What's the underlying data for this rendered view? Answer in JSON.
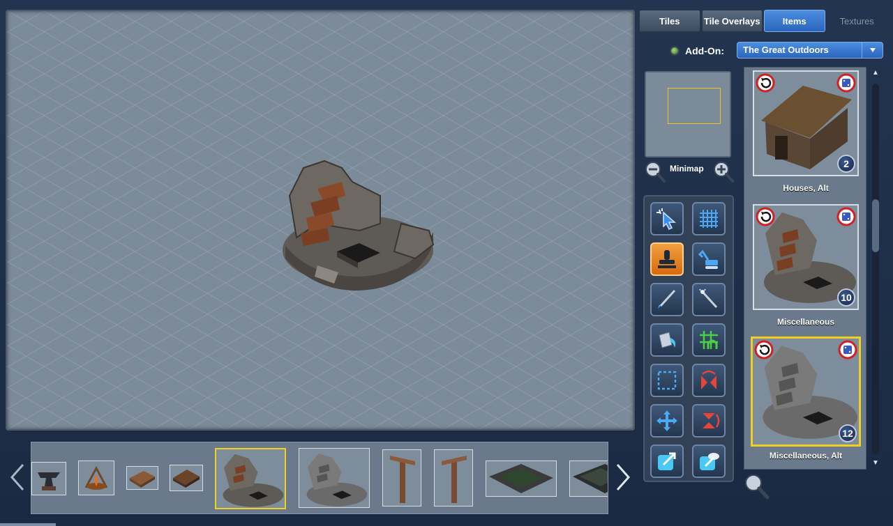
{
  "tabs": [
    {
      "label": "Tiles",
      "state": "normal"
    },
    {
      "label": "Tile Overlays",
      "state": "normal"
    },
    {
      "label": "Items",
      "state": "active"
    },
    {
      "label": "Textures",
      "state": "disabled"
    }
  ],
  "addon": {
    "label": "Add-On:",
    "selected": "The Great Outdoors"
  },
  "minimap": {
    "label": "Minimap"
  },
  "tools": [
    {
      "name": "select-tool",
      "icon": "cursor-sparkle-icon"
    },
    {
      "name": "grid-toggle-tool",
      "icon": "grid-icon"
    },
    {
      "name": "stamp-tool",
      "icon": "stamp-icon",
      "active": true
    },
    {
      "name": "excavate-tool",
      "icon": "excavator-icon"
    },
    {
      "name": "brush-tool",
      "icon": "brush-icon"
    },
    {
      "name": "magic-wand-tool",
      "icon": "magic-wand-icon"
    },
    {
      "name": "fill-tool",
      "icon": "paint-bucket-icon"
    },
    {
      "name": "walkable-grid-tool",
      "icon": "green-grid-arch-icon"
    },
    {
      "name": "marquee-tool",
      "icon": "marquee-icon"
    },
    {
      "name": "flip-horizontal-tool",
      "icon": "flip-horizontal-icon"
    },
    {
      "name": "move-tool",
      "icon": "move-arrows-icon"
    },
    {
      "name": "flip-vertical-tool",
      "icon": "flip-vertical-icon"
    },
    {
      "name": "export-tool",
      "icon": "export-icon"
    },
    {
      "name": "export-cloud-tool",
      "icon": "cloud-export-icon"
    }
  ],
  "items": [
    {
      "title": "Houses, Alt",
      "count": "2",
      "art": "cabin"
    },
    {
      "title": "Miscellaneous",
      "count": "10",
      "art": "ruin"
    },
    {
      "title": "Miscellaneous, Alt",
      "count": "12",
      "art": "ruin-gray",
      "selected": true
    }
  ],
  "recent": [
    "anvil",
    "campfire",
    "log-pile",
    "log-pile-dark",
    "ruin",
    "ruin-gray",
    "signpost",
    "signpost",
    "bridge",
    "bridge-dark"
  ],
  "colors": {
    "accent": "#2a66bd",
    "selection": "#f0d020",
    "active_tool": "#d86a10"
  }
}
